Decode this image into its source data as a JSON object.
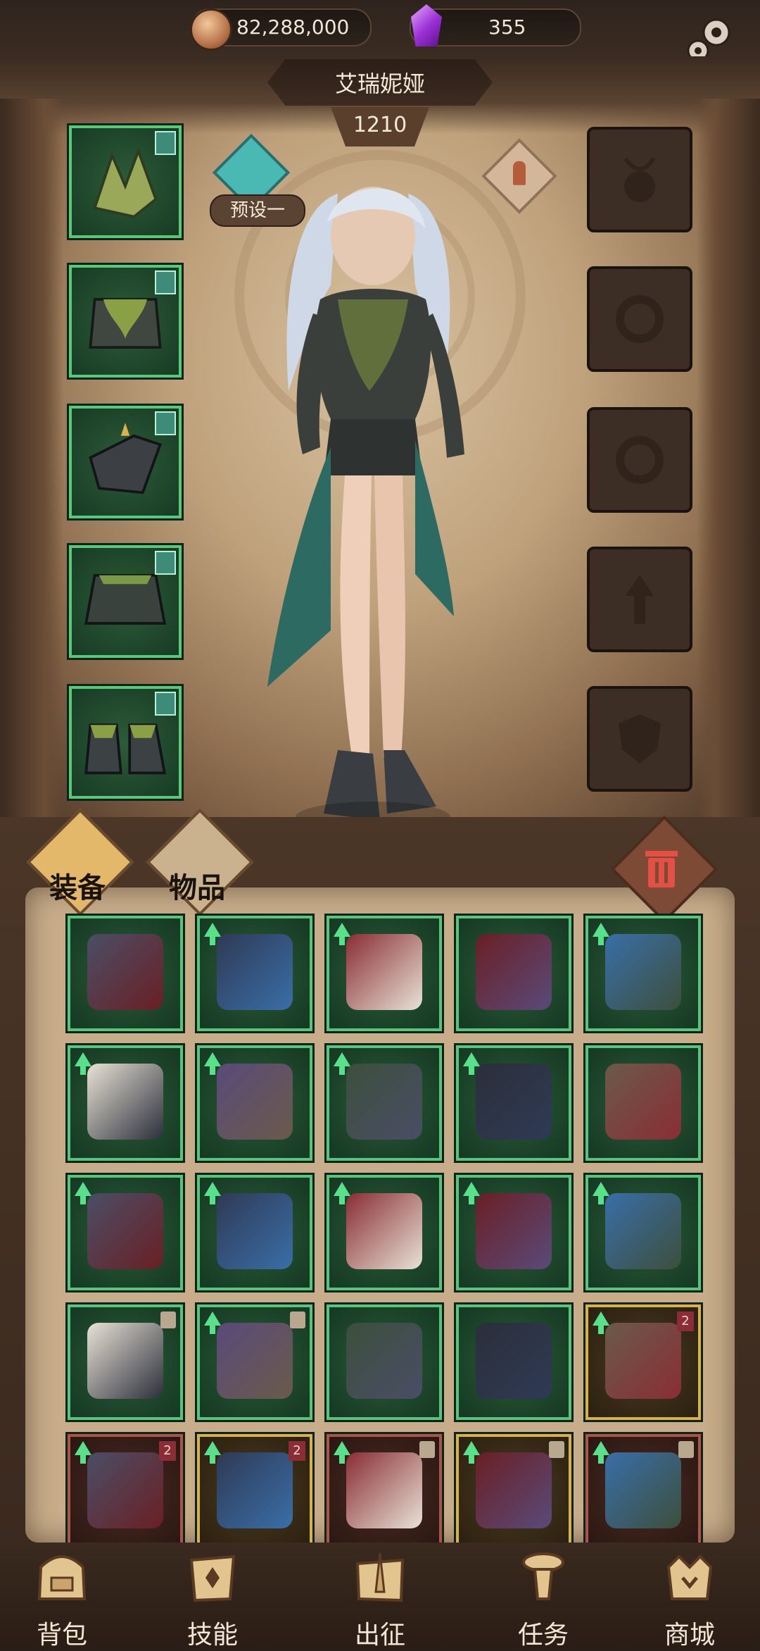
{
  "currency": {
    "coins": "82,288,000",
    "gems": "355"
  },
  "character": {
    "name": "艾瑞妮娅",
    "power": "1210",
    "preset_label": "预设一"
  },
  "equipped_slots": [
    {
      "slot": "weapon",
      "icon": "claw-weapon-icon"
    },
    {
      "slot": "armor",
      "icon": "moss-armor-icon"
    },
    {
      "slot": "gloves",
      "icon": "dark-gauntlet-icon"
    },
    {
      "slot": "pants",
      "icon": "skirt-armor-icon"
    },
    {
      "slot": "boots",
      "icon": "moss-boots-icon"
    }
  ],
  "empty_slots": [
    "necklace-icon",
    "ring-icon",
    "ring-icon",
    "amulet-icon",
    "shield-icon"
  ],
  "tabs": {
    "equip_label": "装备",
    "items_label": "物品"
  },
  "inventory_rows": [
    [
      {
        "icon": "dark-pants-icon",
        "upgrade": false
      },
      {
        "icon": "lightning-blade-icon",
        "upgrade": true
      },
      {
        "icon": "crimson-boots-icon",
        "upgrade": true
      },
      {
        "icon": "red-cloak-icon",
        "upgrade": false
      },
      {
        "icon": "blue-crystal-gauntlet-icon",
        "upgrade": true
      }
    ],
    [
      {
        "icon": "moon-hat-icon",
        "upgrade": true
      },
      {
        "icon": "star-scepter-icon",
        "upgrade": true
      },
      {
        "icon": "golden-greaves-icon",
        "upgrade": true
      },
      {
        "icon": "white-trousers-icon",
        "upgrade": true
      },
      {
        "icon": "royal-robe-icon",
        "upgrade": false
      }
    ],
    [
      {
        "icon": "blue-gauntlet-icon",
        "upgrade": true
      },
      {
        "icon": "plague-coat-icon",
        "upgrade": true
      },
      {
        "icon": "alchemist-belt-icon",
        "upgrade": true
      },
      {
        "icon": "mirror-crest-icon",
        "upgrade": true
      },
      {
        "icon": "violet-boots-icon",
        "upgrade": true
      }
    ],
    [
      {
        "icon": "steel-skirt-icon",
        "upgrade": false,
        "lock": true
      },
      {
        "icon": "frilled-skirt-icon",
        "upgrade": true,
        "lock": true
      },
      {
        "icon": "ruffled-blouse-icon",
        "upgrade": false
      },
      {
        "icon": "lace-collar-icon",
        "upgrade": false
      },
      {
        "icon": "feathered-hat-icon",
        "upgrade": true,
        "num": "2",
        "frame": "gold"
      }
    ],
    [
      {
        "icon": "black-pants-icon",
        "upgrade": true,
        "num": "2",
        "frame": "red"
      },
      {
        "icon": "flower-dress-icon",
        "upgrade": true,
        "num": "2",
        "frame": "gold"
      },
      {
        "icon": "white-boots-icon",
        "upgrade": true,
        "lock": true,
        "frame": "red"
      },
      {
        "icon": "shadow-gauntlet-icon",
        "upgrade": true,
        "lock": true,
        "frame": "gold"
      },
      {
        "icon": "scroll-map-icon",
        "upgrade": true,
        "lock": true,
        "frame": "red"
      }
    ]
  ],
  "nav": {
    "bag": "背包",
    "skills": "技能",
    "expedition": "出征",
    "quests": "任务",
    "shop": "商城"
  },
  "colors": {
    "frame_green": "#59c47c",
    "frame_gold": "#d7b14d",
    "upgrade_arrow": "#58e08a",
    "accent_teal": "#4ab9b4"
  }
}
